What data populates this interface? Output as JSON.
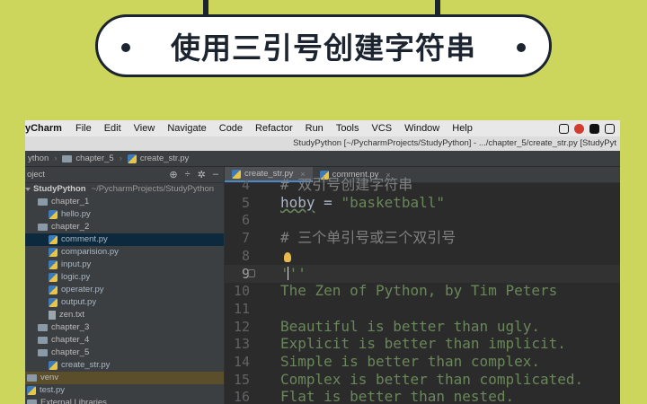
{
  "banner": {
    "title": "使用三引号创建字符串"
  },
  "menubar": {
    "app_name": "yCharm",
    "items": [
      "File",
      "Edit",
      "View",
      "Navigate",
      "Code",
      "Refactor",
      "Run",
      "Tools",
      "VCS",
      "Window",
      "Help"
    ]
  },
  "titlebar": {
    "text": "StudyPython [~/PycharmProjects/StudyPython] - .../chapter_5/create_str.py [StudyPyt"
  },
  "navbar": {
    "crumbs": [
      "ython",
      "chapter_5",
      "create_str.py"
    ]
  },
  "project": {
    "header": "oject",
    "root_name": "StudyPython",
    "root_path": "~/PycharmProjects/StudyPython",
    "tree": [
      {
        "label": "chapter_1",
        "type": "folder",
        "indent": 1
      },
      {
        "label": "hello.py",
        "type": "py",
        "indent": 2
      },
      {
        "label": "chapter_2",
        "type": "folder",
        "indent": 1
      },
      {
        "label": "comment.py",
        "type": "py",
        "indent": 2,
        "selected": true
      },
      {
        "label": "comparision.py",
        "type": "py",
        "indent": 2
      },
      {
        "label": "input.py",
        "type": "py",
        "indent": 2
      },
      {
        "label": "logic.py",
        "type": "py",
        "indent": 2
      },
      {
        "label": "operater.py",
        "type": "py",
        "indent": 2
      },
      {
        "label": "output.py",
        "type": "py",
        "indent": 2
      },
      {
        "label": "zen.txt",
        "type": "txt",
        "indent": 2
      },
      {
        "label": "chapter_3",
        "type": "folder",
        "indent": 1
      },
      {
        "label": "chapter_4",
        "type": "folder",
        "indent": 1
      },
      {
        "label": "chapter_5",
        "type": "folder",
        "indent": 1
      },
      {
        "label": "create_str.py",
        "type": "py",
        "indent": 2
      },
      {
        "label": "venv",
        "type": "folder",
        "indent": 0,
        "venv": true
      },
      {
        "label": "test.py",
        "type": "py",
        "indent": 0
      },
      {
        "label": "External Libraries",
        "type": "folder",
        "indent": 0
      }
    ]
  },
  "tabs": [
    {
      "label": "create_str.py",
      "active": true
    },
    {
      "label": "comment.py",
      "active": false
    }
  ],
  "code": {
    "current_line": 9,
    "lines": [
      {
        "num": "4",
        "kind": "comment",
        "text": "# 双引号创建字符串"
      },
      {
        "num": "5",
        "kind": "assign",
        "var": "hoby",
        "op": " = ",
        "value": "\"basketball\""
      },
      {
        "num": "6",
        "kind": "plain",
        "text": ""
      },
      {
        "num": "7",
        "kind": "comment",
        "text": "# 三个单引号或三个双引号"
      },
      {
        "num": "8",
        "kind": "plain",
        "text": ""
      },
      {
        "num": "9",
        "kind": "str",
        "text": "'''"
      },
      {
        "num": "10",
        "kind": "str",
        "text": "The Zen of Python, by Tim Peters"
      },
      {
        "num": "11",
        "kind": "str",
        "text": ""
      },
      {
        "num": "12",
        "kind": "str",
        "text": "Beautiful is better than ugly."
      },
      {
        "num": "13",
        "kind": "str",
        "text": "Explicit is better than implicit."
      },
      {
        "num": "14",
        "kind": "str",
        "text": "Simple is better than complex."
      },
      {
        "num": "15",
        "kind": "str",
        "text": "Complex is better than complicated."
      },
      {
        "num": "16",
        "kind": "str",
        "text": "Flat is better than nested."
      }
    ]
  }
}
